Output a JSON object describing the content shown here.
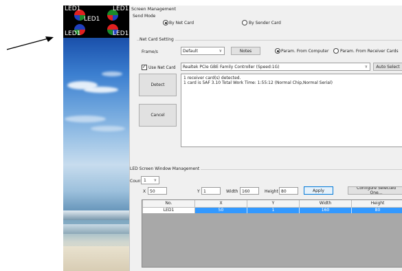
{
  "led_preview": {
    "tiles": [
      {
        "label": "LED1"
      },
      {
        "label": "LED1"
      },
      {
        "label": "LED1"
      },
      {
        "label": "LED1"
      },
      {
        "label": "LED1"
      }
    ],
    "quad_colors": [
      "#e02020",
      "#1a8a2a",
      "#2040c0"
    ]
  },
  "window": {
    "title": "Screen Management",
    "send_mode": {
      "label": "Send Mode",
      "options": [
        {
          "label": "By Net Card",
          "selected": true
        },
        {
          "label": "By Sender Card",
          "selected": false
        }
      ]
    },
    "net_card_setting": {
      "group_label": "Net Card Setting",
      "frames_label": "Frame/s",
      "frames_value": "Default",
      "notes_button": "Notes",
      "param_options": [
        {
          "label": "Param. From Computer",
          "selected": true
        },
        {
          "label": "Param. From Receiver Cards",
          "selected": false
        }
      ],
      "use_net_card_label": "Use Net Card",
      "use_net_card_checked": true,
      "net_card_value": "Realtek PCIe GBE Family Controller (Speed:1G)",
      "auto_select_button": "Auto Select",
      "detect_button": "Detect",
      "cancel_button": "Cancel",
      "log_lines": [
        "1 receiver card(s) detected.",
        "  1 card is 5AF 3.10  Total Work Time: 1:55:12 (Normal Chip,Normal Serial)"
      ]
    },
    "led_window_management": {
      "group_label": "LED Screen Window Management",
      "count_label": "Count",
      "count_value": "1",
      "x_label": "X",
      "x_value": "50",
      "y_label": "Y",
      "y_value": "1",
      "width_label": "Width",
      "width_value": "160",
      "height_label": "Height",
      "height_value": "80",
      "apply_button": "Apply",
      "configure_button": "Configure Selected One...",
      "table": {
        "columns": [
          "No.",
          "X",
          "Y",
          "Width",
          "Height"
        ],
        "rows": [
          [
            "LED1",
            "50",
            "1",
            "160",
            "80"
          ]
        ]
      }
    }
  }
}
